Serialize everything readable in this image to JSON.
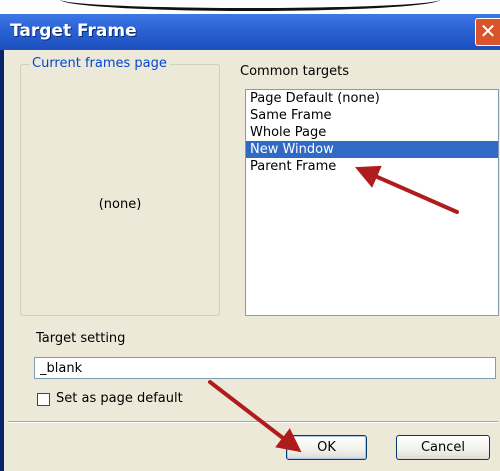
{
  "dialog": {
    "title": "Target Frame",
    "close_glyph": "✕"
  },
  "current_frames": {
    "legend": "Current frames page",
    "value": "(none)"
  },
  "common_targets": {
    "label": "Common targets",
    "items": [
      "Page Default (none)",
      "Same Frame",
      "Whole Page",
      "New Window",
      "Parent Frame"
    ],
    "selected": "New Window"
  },
  "target_setting": {
    "label": "Target setting",
    "value": "_blank"
  },
  "page_default": {
    "label": "Set as page default",
    "checked": false
  },
  "buttons": {
    "ok": "OK",
    "cancel": "Cancel"
  },
  "colors": {
    "titlebar": "#2a62d4",
    "selection": "#316ac5",
    "legend_text": "#0046d5",
    "annotation_arrow": "#b01c1c"
  },
  "icons": [
    "close-icon",
    "checkbox-icon",
    "annotation-arrow"
  ]
}
